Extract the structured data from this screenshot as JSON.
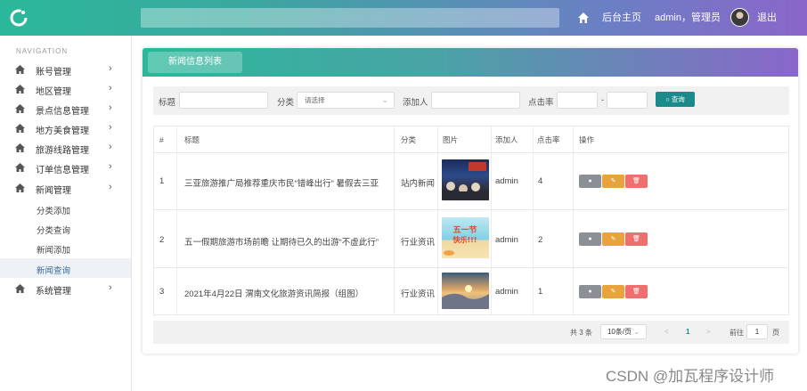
{
  "header": {
    "home_label": "后台主页",
    "user_label": "admin，管理员",
    "logout_label": "退出"
  },
  "sidebar": {
    "nav_title": "NAVIGATION",
    "items": [
      {
        "label": "账号管理"
      },
      {
        "label": "地区管理"
      },
      {
        "label": "景点信息管理"
      },
      {
        "label": "地方美食管理"
      },
      {
        "label": "旅游线路管理"
      },
      {
        "label": "订单信息管理"
      },
      {
        "label": "新闻管理"
      },
      {
        "label": "系统管理"
      }
    ],
    "sub_items": [
      {
        "label": "分类添加"
      },
      {
        "label": "分类查询"
      },
      {
        "label": "新闻添加"
      },
      {
        "label": "新闻查询"
      }
    ]
  },
  "panel": {
    "tab_label": "新闻信息列表"
  },
  "filters": {
    "title_label": "标题",
    "category_label": "分类",
    "category_placeholder": "请选择",
    "adder_label": "添加人",
    "clicks_label": "点击率",
    "range_sep": "-",
    "search_label": "查询"
  },
  "table": {
    "headers": [
      "#",
      "标题",
      "分类",
      "图片",
      "添加人",
      "点击率",
      "操作"
    ],
    "rows": [
      {
        "index": "1",
        "title": "三亚旅游推广局推荐重庆市民“错峰出行” 暑假去三亚",
        "category": "站内新闻",
        "adder": "admin",
        "clicks": "4"
      },
      {
        "index": "2",
        "title": "五一假期旅游市场前瞻 让期待已久的出游“不虚此行”",
        "category": "行业资讯",
        "adder": "admin",
        "clicks": "2"
      },
      {
        "index": "3",
        "title": "2021年4月22日 渭南文化旅游资讯简报（组图）",
        "category": "行业资讯",
        "adder": "admin",
        "clicks": "1"
      }
    ],
    "thumb_text_row2": "五一节 快乐!!!"
  },
  "pagination": {
    "total": "共 3 条",
    "page_size": "10条/页",
    "prev": "<",
    "current": "1",
    "next": ">",
    "goto_label": "前往",
    "goto_value": "1",
    "page_suffix": "页"
  },
  "watermark": "CSDN @加瓦程序设计师",
  "colors": {
    "accent": "#1a8a8a",
    "edit": "#e8a33d",
    "delete": "#ef6e6e",
    "view": "#8c9096"
  }
}
